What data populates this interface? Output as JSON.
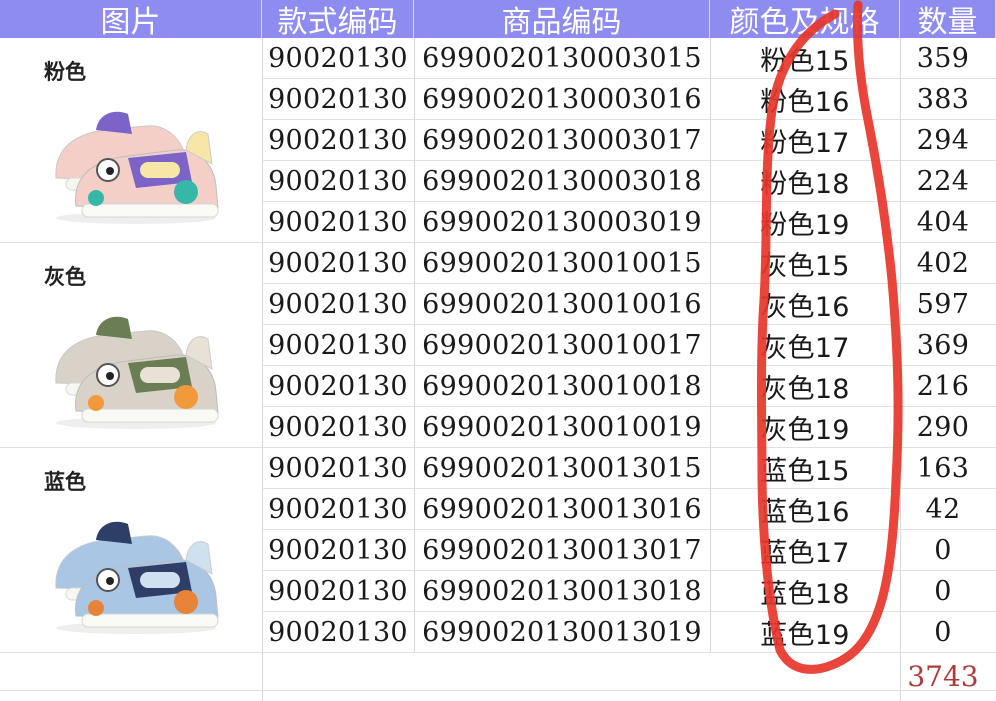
{
  "headers": {
    "image": "图片",
    "style_code": "款式编码",
    "product_code": "商品编码",
    "color_spec": "颜色及规格",
    "quantity": "数量"
  },
  "groups": [
    {
      "label": "粉色",
      "colors": {
        "upper": "#f4cfc8",
        "accent": "#7b63c8",
        "sole": "#35b8a8",
        "trim": "#f6e6a8"
      }
    },
    {
      "label": "灰色",
      "colors": {
        "upper": "#d8d2c8",
        "accent": "#6b7d55",
        "sole": "#f29a3b",
        "trim": "#e8e2d6"
      }
    },
    {
      "label": "蓝色",
      "colors": {
        "upper": "#a9c6e4",
        "accent": "#2e3e66",
        "sole": "#e8833a",
        "trim": "#cfe0f0"
      }
    }
  ],
  "rows": [
    {
      "style": "90020130",
      "code": "6990020130003015",
      "spec": "粉色15",
      "qty": "359"
    },
    {
      "style": "90020130",
      "code": "6990020130003016",
      "spec": "粉色16",
      "qty": "383"
    },
    {
      "style": "90020130",
      "code": "6990020130003017",
      "spec": "粉色17",
      "qty": "294"
    },
    {
      "style": "90020130",
      "code": "6990020130003018",
      "spec": "粉色18",
      "qty": "224"
    },
    {
      "style": "90020130",
      "code": "6990020130003019",
      "spec": "粉色19",
      "qty": "404"
    },
    {
      "style": "90020130",
      "code": "6990020130010015",
      "spec": "灰色15",
      "qty": "402"
    },
    {
      "style": "90020130",
      "code": "6990020130010016",
      "spec": "灰色16",
      "qty": "597"
    },
    {
      "style": "90020130",
      "code": "6990020130010017",
      "spec": "灰色17",
      "qty": "369"
    },
    {
      "style": "90020130",
      "code": "6990020130010018",
      "spec": "灰色18",
      "qty": "216"
    },
    {
      "style": "90020130",
      "code": "6990020130010019",
      "spec": "灰色19",
      "qty": "290"
    },
    {
      "style": "90020130",
      "code": "6990020130013015",
      "spec": "蓝色15",
      "qty": "163"
    },
    {
      "style": "90020130",
      "code": "6990020130013016",
      "spec": "蓝色16",
      "qty": "42"
    },
    {
      "style": "90020130",
      "code": "6990020130013017",
      "spec": "蓝色17",
      "qty": "0"
    },
    {
      "style": "90020130",
      "code": "6990020130013018",
      "spec": "蓝色18",
      "qty": "0"
    },
    {
      "style": "90020130",
      "code": "6990020130013019",
      "spec": "蓝色19",
      "qty": "0"
    }
  ],
  "total": "3743",
  "annotation": {
    "name": "red-marker-scribble",
    "color": "#e8352a"
  }
}
